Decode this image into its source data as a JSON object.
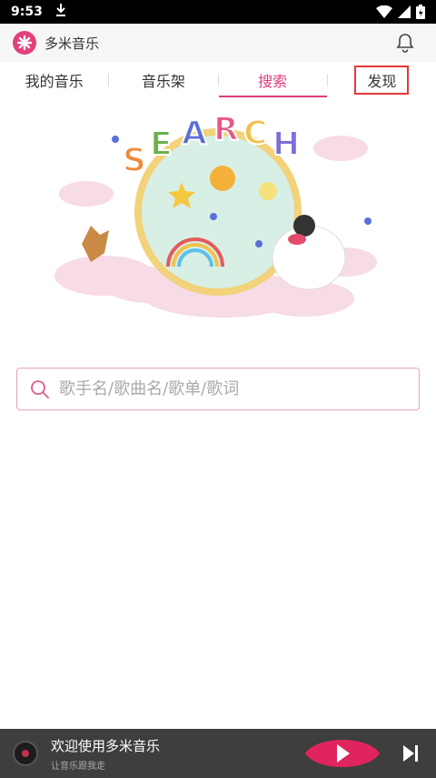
{
  "status": {
    "time": "9:53"
  },
  "app": {
    "title": "多米音乐"
  },
  "tabs": [
    {
      "label": "我的音乐"
    },
    {
      "label": "音乐架"
    },
    {
      "label": "搜索"
    },
    {
      "label": "发现"
    }
  ],
  "illustration": {
    "word": "SEARCH"
  },
  "search": {
    "placeholder": "歌手名/歌曲名/歌单/歌词"
  },
  "player": {
    "title": "欢迎使用多米音乐",
    "subtitle": "让音乐跟我走"
  },
  "colors": {
    "accent": "#e03c7d",
    "player_bg": "#3e3e3e",
    "highlight_box": "#e53935"
  }
}
